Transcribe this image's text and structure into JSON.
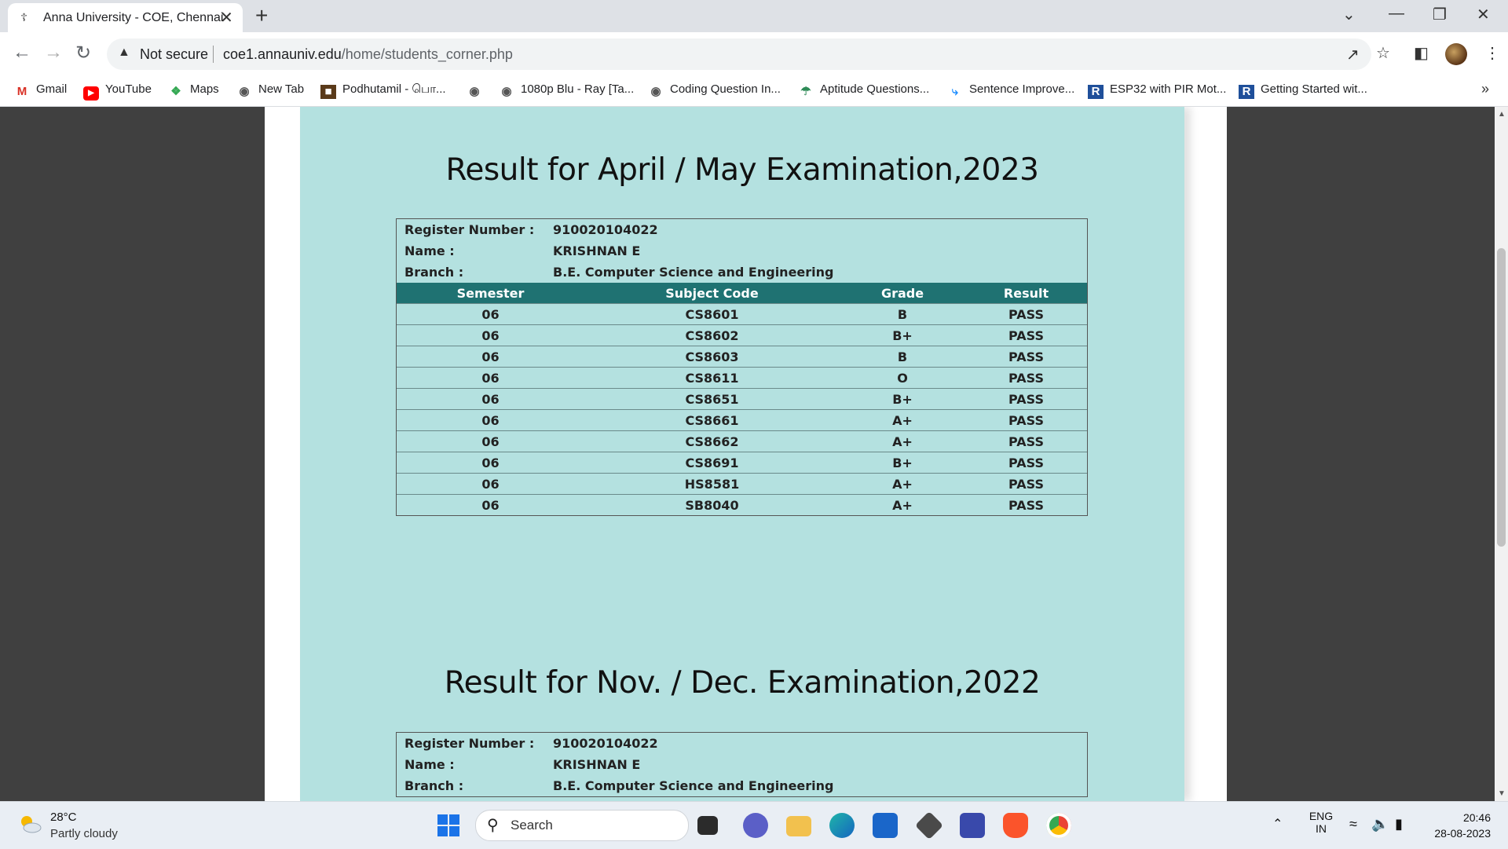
{
  "browser": {
    "tab_title": "Anna University - COE, Chennai",
    "security_label": "Not secure",
    "url_host": "coe1.annauniv.edu",
    "url_path": "/home/students_corner.php",
    "bookmarks": [
      {
        "label": "Gmail",
        "icon": "gmail-icon"
      },
      {
        "label": "YouTube",
        "icon": "youtube-icon"
      },
      {
        "label": "Maps",
        "icon": "maps-icon"
      },
      {
        "label": "New Tab",
        "icon": "globe-icon"
      },
      {
        "label": "Podhutamil - பொ...",
        "icon": "podhutamil-icon"
      },
      {
        "label": "",
        "icon": "globe-icon"
      },
      {
        "label": "1080p Blu - Ray [Ta...",
        "icon": "globe-icon"
      },
      {
        "label": "Coding Question In...",
        "icon": "globe-icon"
      },
      {
        "label": "Aptitude Questions...",
        "icon": "umbrella-icon"
      },
      {
        "label": "Sentence Improve...",
        "icon": "runner-icon"
      },
      {
        "label": "ESP32 with PIR Mot...",
        "icon": "r-logo-icon"
      },
      {
        "label": "Getting Started wit...",
        "icon": "r-logo-icon"
      }
    ],
    "more_bookmarks": "»"
  },
  "page": {
    "results": [
      {
        "heading": "Result for April / May Examination,2023",
        "register_label": "Register Number :",
        "register_number": "910020104022",
        "name_label": "Name :",
        "name": "KRISHNAN E",
        "branch_label": "Branch :",
        "branch": "B.E. Computer Science and Engineering",
        "columns": [
          "Semester",
          "Subject Code",
          "Grade",
          "Result"
        ],
        "rows": [
          {
            "semester": "06",
            "subject_code": "CS8601",
            "grade": "B",
            "result": "PASS"
          },
          {
            "semester": "06",
            "subject_code": "CS8602",
            "grade": "B+",
            "result": "PASS"
          },
          {
            "semester": "06",
            "subject_code": "CS8603",
            "grade": "B",
            "result": "PASS"
          },
          {
            "semester": "06",
            "subject_code": "CS8611",
            "grade": "O",
            "result": "PASS"
          },
          {
            "semester": "06",
            "subject_code": "CS8651",
            "grade": "B+",
            "result": "PASS"
          },
          {
            "semester": "06",
            "subject_code": "CS8661",
            "grade": "A+",
            "result": "PASS"
          },
          {
            "semester": "06",
            "subject_code": "CS8662",
            "grade": "A+",
            "result": "PASS"
          },
          {
            "semester": "06",
            "subject_code": "CS8691",
            "grade": "B+",
            "result": "PASS"
          },
          {
            "semester": "06",
            "subject_code": "HS8581",
            "grade": "A+",
            "result": "PASS"
          },
          {
            "semester": "06",
            "subject_code": "SB8040",
            "grade": "A+",
            "result": "PASS"
          }
        ]
      },
      {
        "heading": "Result for Nov. / Dec. Examination,2022",
        "register_label": "Register Number :",
        "register_number": "910020104022",
        "name_label": "Name :",
        "name": "KRISHNAN E",
        "branch_label": "Branch :",
        "branch": "B.E. Computer Science and Engineering"
      }
    ]
  },
  "taskbar": {
    "weather_temp": "28°C",
    "weather_desc": "Partly cloudy",
    "search_label": "Search",
    "language": "ENG",
    "region": "IN",
    "time": "20:46",
    "date": "28-08-2023"
  },
  "colors": {
    "page_background": "#b4e1e0",
    "table_header": "#1f7272",
    "outer_background": "#404040"
  }
}
